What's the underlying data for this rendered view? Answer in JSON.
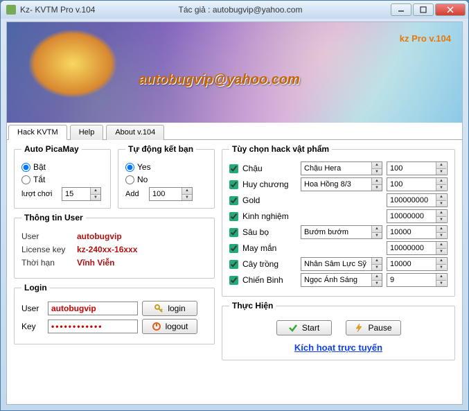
{
  "window": {
    "title": "Kz- KVTM Pro v.104",
    "author_label": "Tác giả : autobugvip@yahoo.com"
  },
  "banner": {
    "version": "kz Pro v.104",
    "email": "autobugvip@yahoo.com"
  },
  "tabs": {
    "hack": "Hack KVTM",
    "help": "Help",
    "about": "About v.104"
  },
  "picamay": {
    "legend": "Auto PicaMay",
    "on": "Bật",
    "off": "Tắt",
    "plays_label": "lượt chơi",
    "plays_value": "15"
  },
  "friend": {
    "legend": "Tự động kết bạn",
    "yes": "Yes",
    "no": "No",
    "add_label": "Add",
    "add_value": "100"
  },
  "userinfo": {
    "legend": "Thông tin User",
    "user_label": "User",
    "user_value": "autobugvip",
    "license_label": "License key",
    "license_value": "kz-240xx-16xxx",
    "expire_label": "Thời hạn",
    "expire_value": "Vĩnh Viễn"
  },
  "login": {
    "legend": "Login",
    "user_label": "User",
    "user_value": "autobugvip",
    "key_label": "Key",
    "key_value": "••••••••••••",
    "login_btn": "login",
    "logout_btn": "logout"
  },
  "hack": {
    "legend": "Tùy chọn hack vật phẩm",
    "items": [
      {
        "label": "Chậu",
        "combo": "Chậu Hera",
        "value": "100"
      },
      {
        "label": "Huy chương",
        "combo": "Hoa Hồng 8/3",
        "value": "100"
      },
      {
        "label": "Gold",
        "combo": null,
        "value": "100000000"
      },
      {
        "label": "Kinh nghiệm",
        "combo": null,
        "value": "10000000"
      },
      {
        "label": "Sâu bọ",
        "combo": "Bướm bướm",
        "value": "10000"
      },
      {
        "label": "May mắn",
        "combo": null,
        "value": "10000000"
      },
      {
        "label": "Cây trồng",
        "combo": "Nhân Sâm Lực Sỹ",
        "value": "10000"
      },
      {
        "label": "Chiến Binh",
        "combo": "Ngọc Ánh Sáng",
        "value": "9"
      }
    ]
  },
  "exec": {
    "legend": "Thực Hiện",
    "start": "Start",
    "pause": "Pause",
    "activate": "Kích hoạt trực tuyến"
  }
}
